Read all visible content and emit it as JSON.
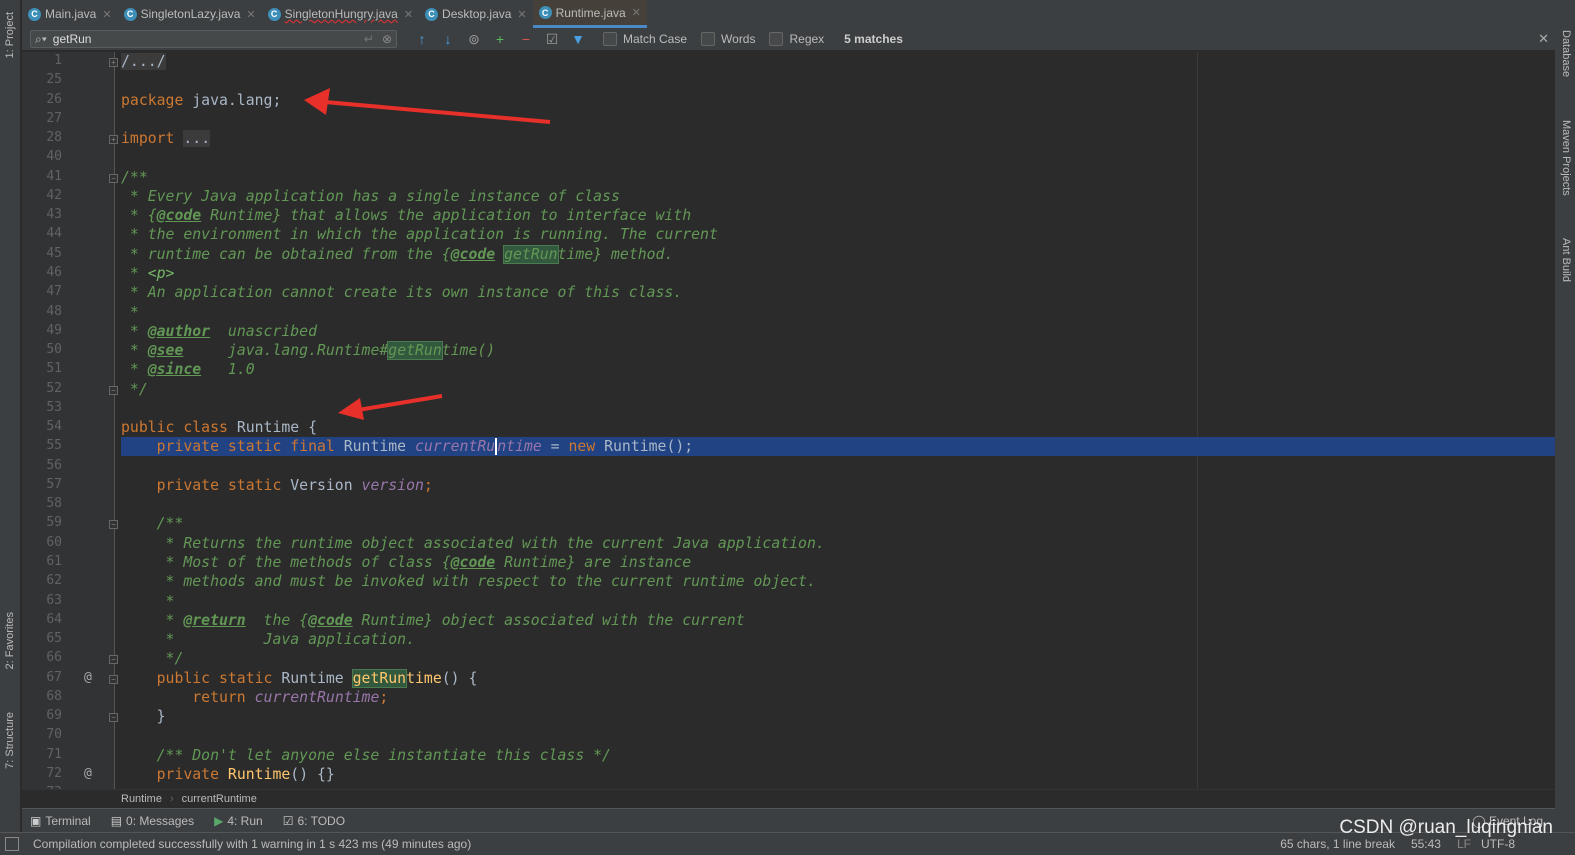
{
  "tabs": [
    {
      "label": "Main.java",
      "active": false
    },
    {
      "label": "SingletonLazy.java",
      "active": false
    },
    {
      "label": "SingletonHungry.java",
      "active": false
    },
    {
      "label": "Desktop.java",
      "active": false
    },
    {
      "label": "Runtime.java",
      "active": true
    }
  ],
  "search": {
    "query": "getRun",
    "match_case": "Match Case",
    "words": "Words",
    "regex": "Regex",
    "matches": "5 matches"
  },
  "left_tools": {
    "project": "1: Project",
    "favorites": "2: Favorites",
    "structure": "7: Structure"
  },
  "right_tools": {
    "database": "Database",
    "maven": "Maven Projects",
    "ant": "Ant Build"
  },
  "code": [
    {
      "n": "1",
      "segs": [
        [
          "/.../",
          "fold"
        ]
      ]
    },
    {
      "n": "25",
      "segs": []
    },
    {
      "n": "26",
      "segs": [
        [
          "package",
          "kw"
        ],
        [
          " java.lang;",
          "tx"
        ]
      ]
    },
    {
      "n": "27",
      "segs": []
    },
    {
      "n": "28",
      "segs": [
        [
          "import",
          "kw"
        ],
        [
          " ",
          "tx"
        ],
        [
          "...",
          "fold"
        ]
      ]
    },
    {
      "n": "40",
      "segs": []
    },
    {
      "n": "41",
      "segs": [
        [
          "/**",
          "doc"
        ]
      ]
    },
    {
      "n": "42",
      "segs": [
        [
          " * Every Java application has a single instance of class",
          "doc"
        ]
      ]
    },
    {
      "n": "43",
      "segs": [
        [
          " * {",
          "doc"
        ],
        [
          "@code",
          "tag"
        ],
        [
          " Runtime} that allows the application to interface with",
          "doc"
        ]
      ]
    },
    {
      "n": "44",
      "segs": [
        [
          " * the environment in which the application is running. The current",
          "doc"
        ]
      ]
    },
    {
      "n": "45",
      "segs": [
        [
          " * runtime can be obtained from the {",
          "doc"
        ],
        [
          "@code",
          "tag"
        ],
        [
          " ",
          "doc"
        ],
        [
          "getRun",
          "doc match"
        ],
        [
          "time} method.",
          "doc"
        ]
      ]
    },
    {
      "n": "46",
      "segs": [
        [
          " * ",
          "doc"
        ],
        [
          "<p>",
          "ht"
        ]
      ]
    },
    {
      "n": "47",
      "segs": [
        [
          " * An application cannot create its own instance of this class.",
          "doc"
        ]
      ]
    },
    {
      "n": "48",
      "segs": [
        [
          " *",
          "doc"
        ]
      ]
    },
    {
      "n": "49",
      "segs": [
        [
          " * ",
          "doc"
        ],
        [
          "@author",
          "tag"
        ],
        [
          "  unascribed",
          "doc"
        ]
      ]
    },
    {
      "n": "50",
      "segs": [
        [
          " * ",
          "doc"
        ],
        [
          "@see",
          "tag"
        ],
        [
          "     java.lang.Runtime#",
          "doc"
        ],
        [
          "getRun",
          "doc match"
        ],
        [
          "time()",
          "doc"
        ]
      ]
    },
    {
      "n": "51",
      "segs": [
        [
          " * ",
          "doc"
        ],
        [
          "@since",
          "tag"
        ],
        [
          "   1.0",
          "doc"
        ]
      ]
    },
    {
      "n": "52",
      "segs": [
        [
          " */",
          "doc"
        ]
      ]
    },
    {
      "n": "53",
      "segs": []
    },
    {
      "n": "54",
      "segs": [
        [
          "public class",
          "kw"
        ],
        [
          " Runtime {",
          "tx"
        ]
      ]
    },
    {
      "n": "55",
      "hl": true,
      "segs": [
        [
          "    private static final",
          "kw"
        ],
        [
          " Runtime ",
          "tx"
        ],
        [
          "currentRu",
          "fld"
        ],
        [
          "ntime",
          "fld caret"
        ],
        [
          " = ",
          "tx"
        ],
        [
          "new",
          "kw"
        ],
        [
          " Runtime();",
          "tx"
        ]
      ]
    },
    {
      "n": "56",
      "segs": []
    },
    {
      "n": "57",
      "segs": [
        [
          "    private static",
          "kw"
        ],
        [
          " Version ",
          "tx"
        ],
        [
          "version",
          "fld"
        ],
        [
          ";",
          "kw"
        ]
      ]
    },
    {
      "n": "58",
      "segs": []
    },
    {
      "n": "59",
      "segs": [
        [
          "    /**",
          "doc"
        ]
      ]
    },
    {
      "n": "60",
      "segs": [
        [
          "     * Returns the runtime object associated with the current Java application.",
          "doc"
        ]
      ]
    },
    {
      "n": "61",
      "segs": [
        [
          "     * Most of the methods of class {",
          "doc"
        ],
        [
          "@code",
          "tag"
        ],
        [
          " Runtime} are instance",
          "doc"
        ]
      ]
    },
    {
      "n": "62",
      "segs": [
        [
          "     * methods and must be invoked with respect to the current runtime object.",
          "doc"
        ]
      ]
    },
    {
      "n": "63",
      "segs": [
        [
          "     *",
          "doc"
        ]
      ]
    },
    {
      "n": "64",
      "segs": [
        [
          "     * ",
          "doc"
        ],
        [
          "@return",
          "tag"
        ],
        [
          "  the {",
          "doc"
        ],
        [
          "@code",
          "tag"
        ],
        [
          " Runtime} object associated with the current",
          "doc"
        ]
      ]
    },
    {
      "n": "65",
      "segs": [
        [
          "     *          Java application.",
          "doc"
        ]
      ]
    },
    {
      "n": "66",
      "segs": [
        [
          "     */",
          "doc"
        ]
      ]
    },
    {
      "n": "67",
      "segs": [
        [
          "    public static",
          "kw"
        ],
        [
          " Runtime ",
          "tx"
        ],
        [
          "getRun",
          "mth match"
        ],
        [
          "time",
          "mth"
        ],
        [
          "() {",
          "tx"
        ]
      ]
    },
    {
      "n": "68",
      "segs": [
        [
          "        return",
          "kw"
        ],
        [
          " ",
          "tx"
        ],
        [
          "currentRuntime",
          "fld"
        ],
        [
          ";",
          "kw"
        ]
      ]
    },
    {
      "n": "69",
      "segs": [
        [
          "    }",
          "tx"
        ]
      ]
    },
    {
      "n": "70",
      "segs": []
    },
    {
      "n": "71",
      "segs": [
        [
          "    /** Don't let anyone else instantiate this class */",
          "doc"
        ]
      ]
    },
    {
      "n": "72",
      "segs": [
        [
          "    private",
          "kw"
        ],
        [
          " ",
          "tx"
        ],
        [
          "Runtime",
          "mth"
        ],
        [
          "() {}",
          "tx"
        ]
      ]
    },
    {
      "n": "73",
      "segs": []
    }
  ],
  "breadcrumb": [
    "Runtime",
    "currentRuntime"
  ],
  "toolwindows": [
    {
      "label": "Terminal",
      "icon": "terminal-icon"
    },
    {
      "label": "0: Messages",
      "icon": "messages-icon"
    },
    {
      "label": "4: Run",
      "icon": "run-icon"
    },
    {
      "label": "6: TODO",
      "icon": "todo-icon"
    }
  ],
  "event_log": "Event Log",
  "status": {
    "message": "Compilation completed successfully with 1 warning in 1 s 423 ms (49 minutes ago)",
    "selection": "65 chars, 1 line break",
    "position": "55:43",
    "line_sep": "LF",
    "encoding": "UTF-8"
  },
  "watermark": "CSDN @ruan_luqingnian",
  "colors": {
    "background": "#2b2b2b",
    "keyword": "#cc7832",
    "comment": "#629755",
    "selection": "#214283",
    "annotation_arrow": "#e8302a"
  }
}
